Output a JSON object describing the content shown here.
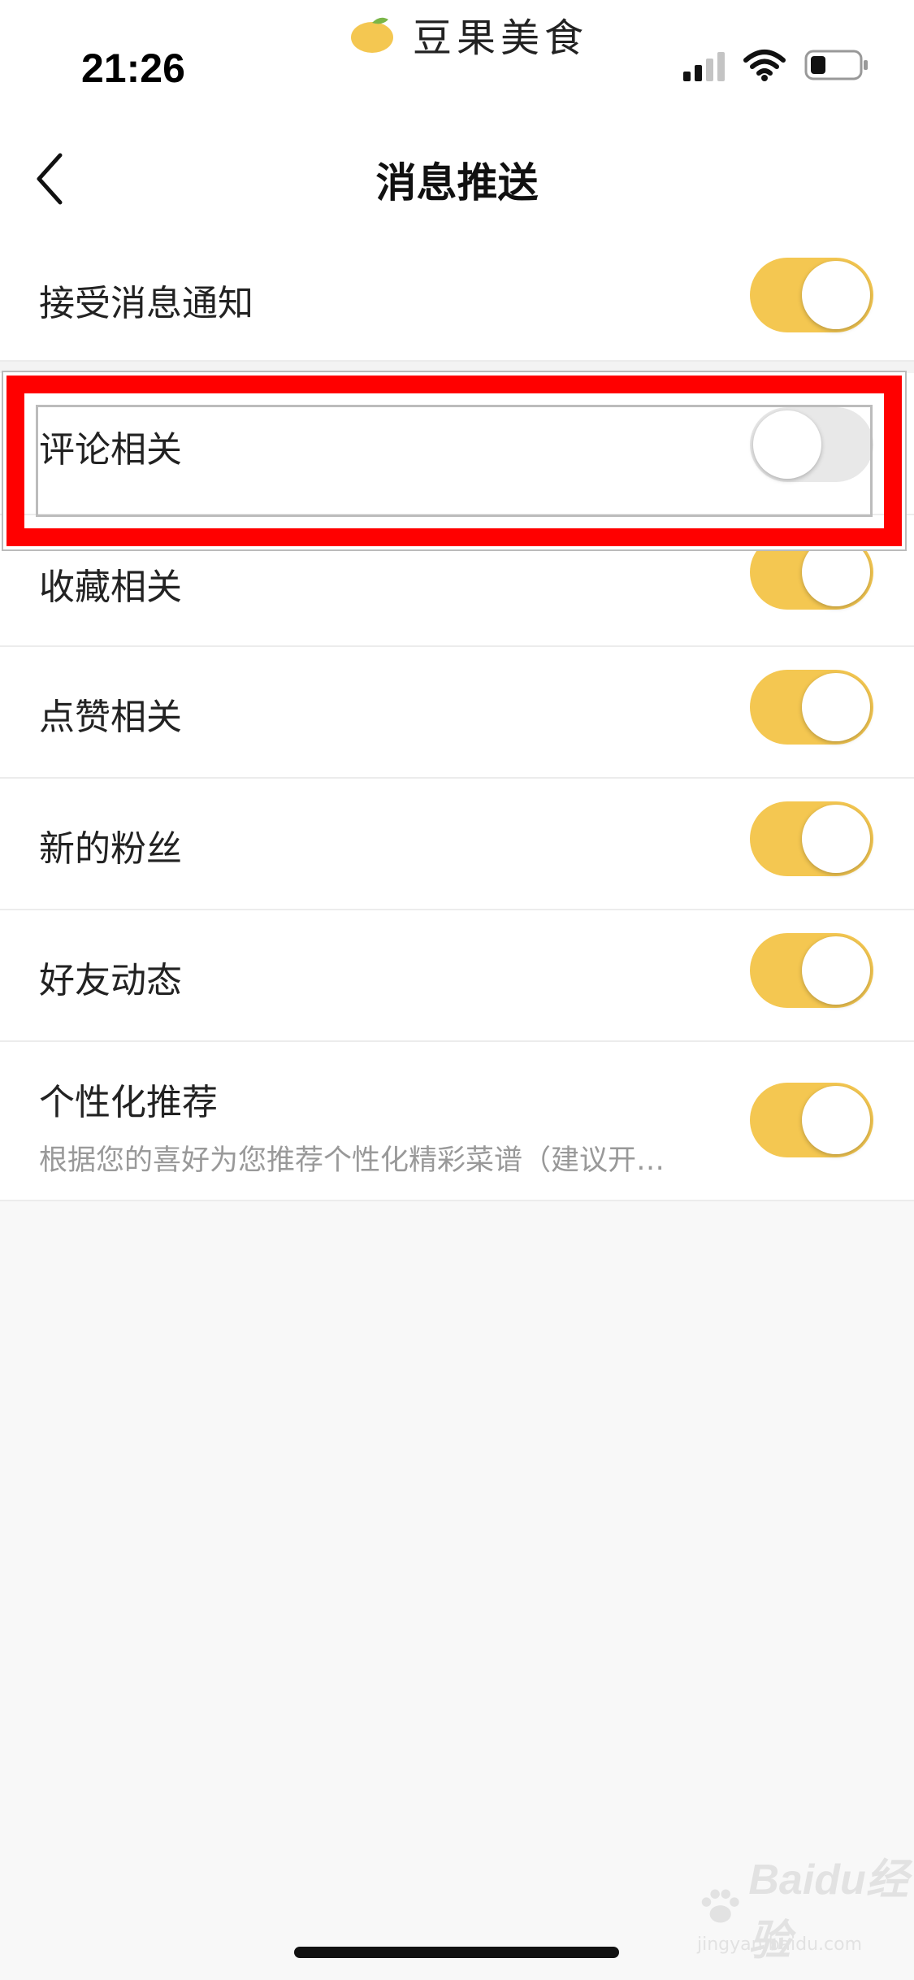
{
  "status_bar": {
    "time": "21:26",
    "brand_name": "豆果美食"
  },
  "nav": {
    "title": "消息推送",
    "back_icon": "chevron-left-icon"
  },
  "settings": [
    {
      "label": "接受消息通知",
      "enabled": true
    },
    {
      "label": "评论相关",
      "enabled": false,
      "highlighted": true
    },
    {
      "label": "收藏相关",
      "enabled": true
    },
    {
      "label": "点赞相关",
      "enabled": true
    },
    {
      "label": "新的粉丝",
      "enabled": true
    },
    {
      "label": "好友动态",
      "enabled": true
    },
    {
      "label": "个性化推荐",
      "description": "根据您的喜好为您推荐个性化精彩菜谱（建议开…",
      "enabled": true
    }
  ],
  "watermark": {
    "text": "Baidu经验",
    "sub": "jingyan.baidu.com"
  },
  "colors": {
    "toggle_on": "#f4c751",
    "toggle_off": "#e8e8e8",
    "highlight": "#ff0000",
    "background": "#f8f8f8"
  }
}
